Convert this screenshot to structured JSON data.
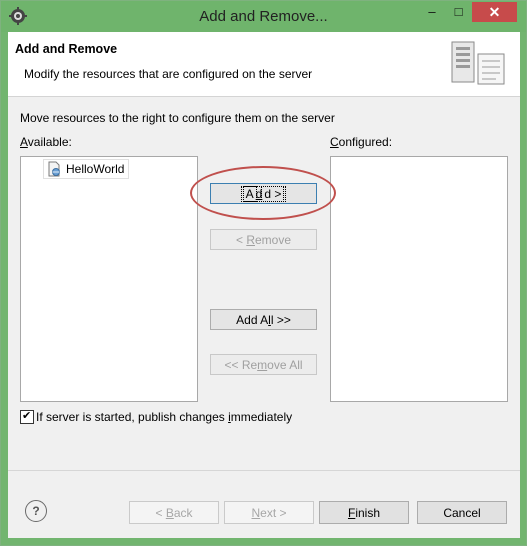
{
  "window": {
    "title": "Add and Remove...",
    "minimize_glyph": "–",
    "maximize_glyph": "□",
    "close_glyph": "✕"
  },
  "header": {
    "title": "Add and Remove",
    "description": "Modify the resources that are configured on the server"
  },
  "message": "Move resources to the right to configure them on the server",
  "available": {
    "label_first": "A",
    "label_rest": "vailable:",
    "items": [
      "HelloWorld"
    ]
  },
  "configured": {
    "label_first": "C",
    "label_rest": "onfigured:",
    "items": []
  },
  "buttons": {
    "add_pre": "A",
    "add_ul": "d",
    "add_post": "d >",
    "remove_pre": "< ",
    "remove_ul": "R",
    "remove_post": "emove",
    "addall_pre": "Add A",
    "addall_ul": "l",
    "addall_post": "l >>",
    "removeall_pre": "<< Re",
    "removeall_ul": "m",
    "removeall_post": "ove All"
  },
  "publish_checkbox": {
    "checked": true,
    "check_glyph": "✔",
    "label_pre": "If server is started, publish changes ",
    "label_ul": "i",
    "label_post": "mmediately"
  },
  "footer": {
    "help_glyph": "?",
    "back_pre": "< ",
    "back_ul": "B",
    "back_post": "ack",
    "next_ul": "N",
    "next_post": "ext >",
    "finish_ul": "F",
    "finish_post": "inish",
    "cancel": "Cancel"
  },
  "colors": {
    "titlebar": "#6fb46c",
    "close_button": "#c74b4b",
    "highlight_ellipse": "#c0504d",
    "dialog_bg": "#f0f0f0"
  },
  "icons": {
    "app": "eclipse-gear-icon",
    "header": "server-wizard-icon",
    "project": "web-project-icon"
  }
}
